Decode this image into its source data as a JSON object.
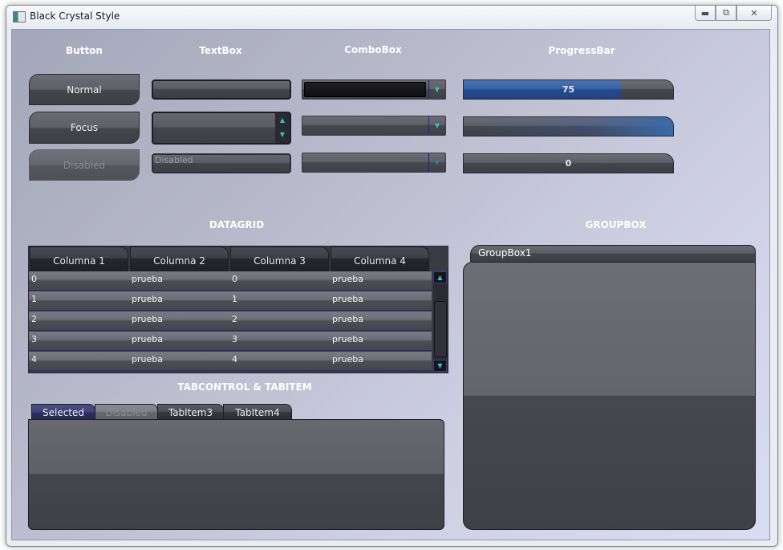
{
  "window": {
    "title": "Black Crystal Style",
    "caption_buttons": [
      "minimize",
      "maximize",
      "close"
    ]
  },
  "headers": {
    "button": "Button",
    "textbox": "TextBox",
    "combobox": "ComboBox",
    "progressbar": "ProgressBar",
    "datagrid": "DATAGRID",
    "groupbox": "GROUPBOX",
    "tabcontrol": "TABCONTROL & TABITEM"
  },
  "buttons": {
    "normal": "Normal",
    "focus": "Focus",
    "disabled": "Disabled"
  },
  "textboxes": {
    "disabled_text": "Disabled"
  },
  "progress": {
    "first_value": 75,
    "first_label": "75",
    "third_value": 0,
    "third_label": "0"
  },
  "datagrid": {
    "columns": [
      "Columna 1",
      "Columna 2",
      "Columna 3",
      "Columna 4"
    ],
    "rows": [
      [
        "0",
        "prueba",
        "0",
        "prueba"
      ],
      [
        "1",
        "prueba",
        "1",
        "prueba"
      ],
      [
        "2",
        "prueba",
        "2",
        "prueba"
      ],
      [
        "3",
        "prueba",
        "3",
        "prueba"
      ],
      [
        "4",
        "prueba",
        "4",
        "prueba"
      ]
    ]
  },
  "tabs": [
    "Selected",
    "Disabled",
    "TabItem3",
    "TabItem4"
  ],
  "groupbox": {
    "title": "GroupBox1"
  },
  "colors": {
    "accent_cyan": "#2ec4c4",
    "progress_blue": "#3a64a8",
    "selected_tab": "#3e427a"
  }
}
